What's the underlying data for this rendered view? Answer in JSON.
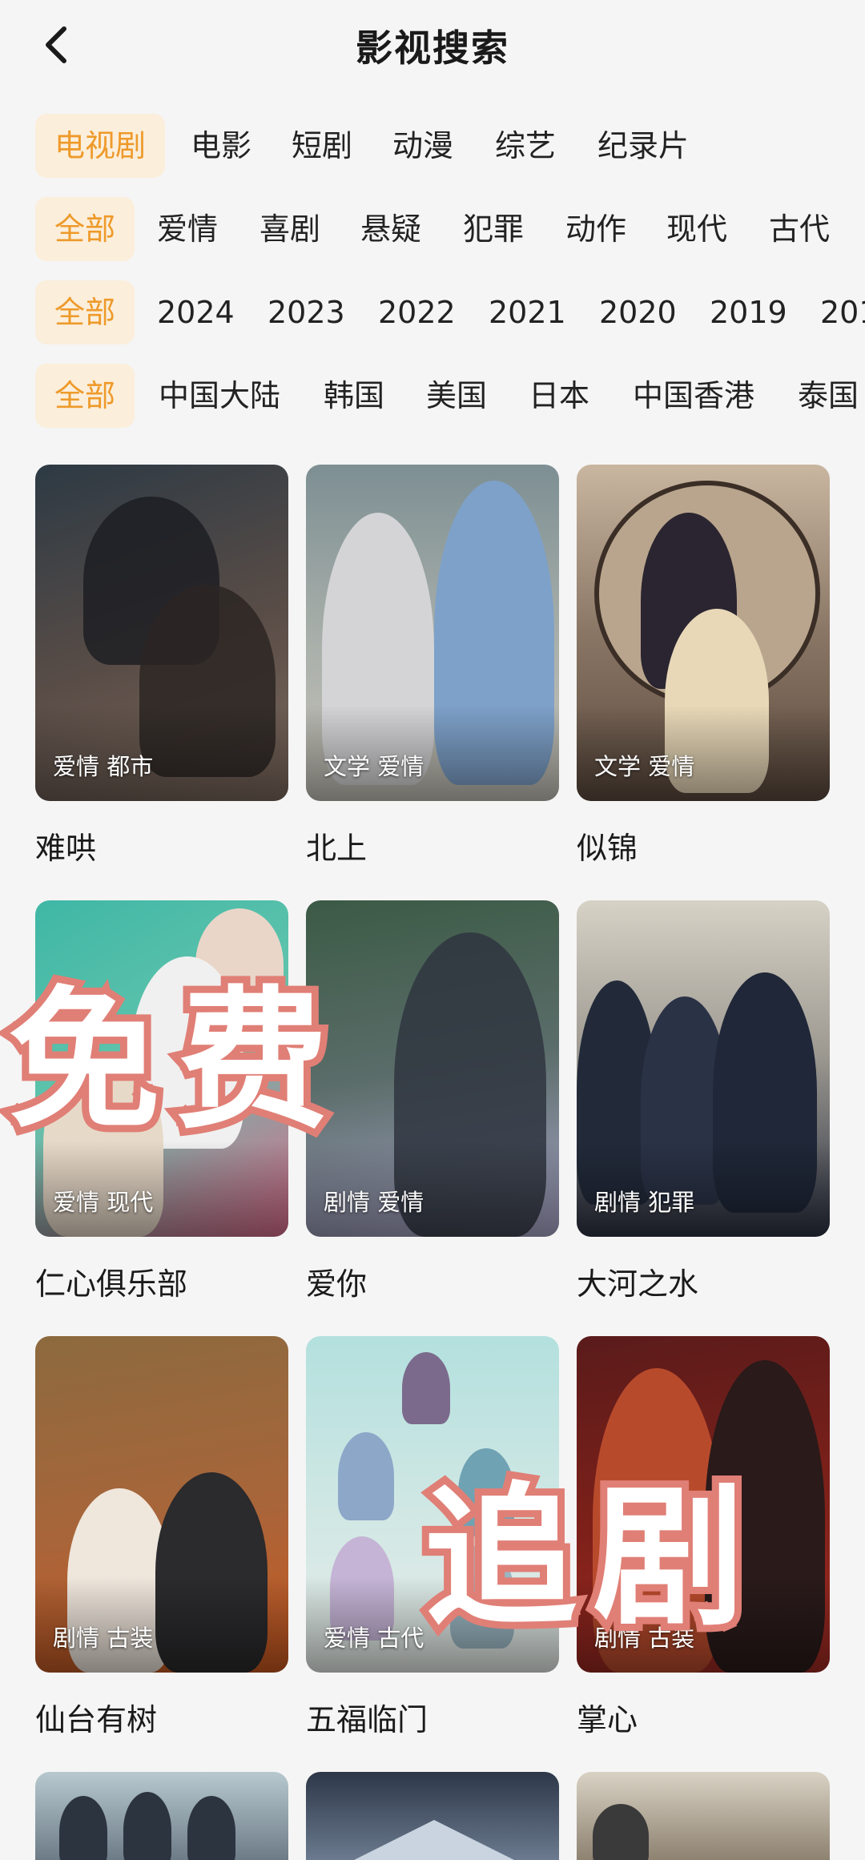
{
  "header": {
    "title": "影视搜索",
    "back_icon": "chevron-left-icon"
  },
  "filters": {
    "types": [
      "电视剧",
      "电影",
      "短剧",
      "动漫",
      "综艺",
      "纪录片"
    ],
    "genres": [
      "全部",
      "爱情",
      "喜剧",
      "悬疑",
      "犯罪",
      "动作",
      "现代",
      "古代"
    ],
    "years": [
      "全部",
      "2024",
      "2023",
      "2022",
      "2021",
      "2020",
      "2019",
      "201"
    ],
    "regions": [
      "全部",
      "中国大陆",
      "韩国",
      "美国",
      "日本",
      "中国香港",
      "泰国"
    ]
  },
  "cards": [
    {
      "title": "难哄",
      "tags": "爱情 都市",
      "colors": [
        "#2d3a44",
        "#7c6a5e"
      ]
    },
    {
      "title": "北上",
      "tags": "文学 爱情",
      "colors": [
        "#7d8f93",
        "#c7c3b9"
      ]
    },
    {
      "title": "似锦",
      "tags": "文学 爱情",
      "colors": [
        "#5c4a3e",
        "#c9b6a0"
      ]
    },
    {
      "title": "仁心俱乐部",
      "tags": "爱情 现代",
      "colors": [
        "#3fb7a5",
        "#d96a8b"
      ]
    },
    {
      "title": "爱你",
      "tags": "剧情 爱情",
      "colors": [
        "#3b5a45",
        "#a9a6c9"
      ]
    },
    {
      "title": "大河之水",
      "tags": "剧情 犯罪",
      "colors": [
        "#d6d2c6",
        "#2c3242"
      ]
    },
    {
      "title": "仙台有树",
      "tags": "剧情 古装",
      "colors": [
        "#8c6a3e",
        "#c8571f"
      ]
    },
    {
      "title": "五福临门",
      "tags": "爱情 古代",
      "colors": [
        "#b3e0de",
        "#e7ece8"
      ]
    },
    {
      "title": "掌心",
      "tags": "剧情 古装",
      "colors": [
        "#5a1b1b",
        "#a02a22"
      ]
    }
  ],
  "overlay": {
    "word1": "免费",
    "word2": "追剧",
    "color": "#e07f76"
  },
  "accent": "#ee9a2a"
}
